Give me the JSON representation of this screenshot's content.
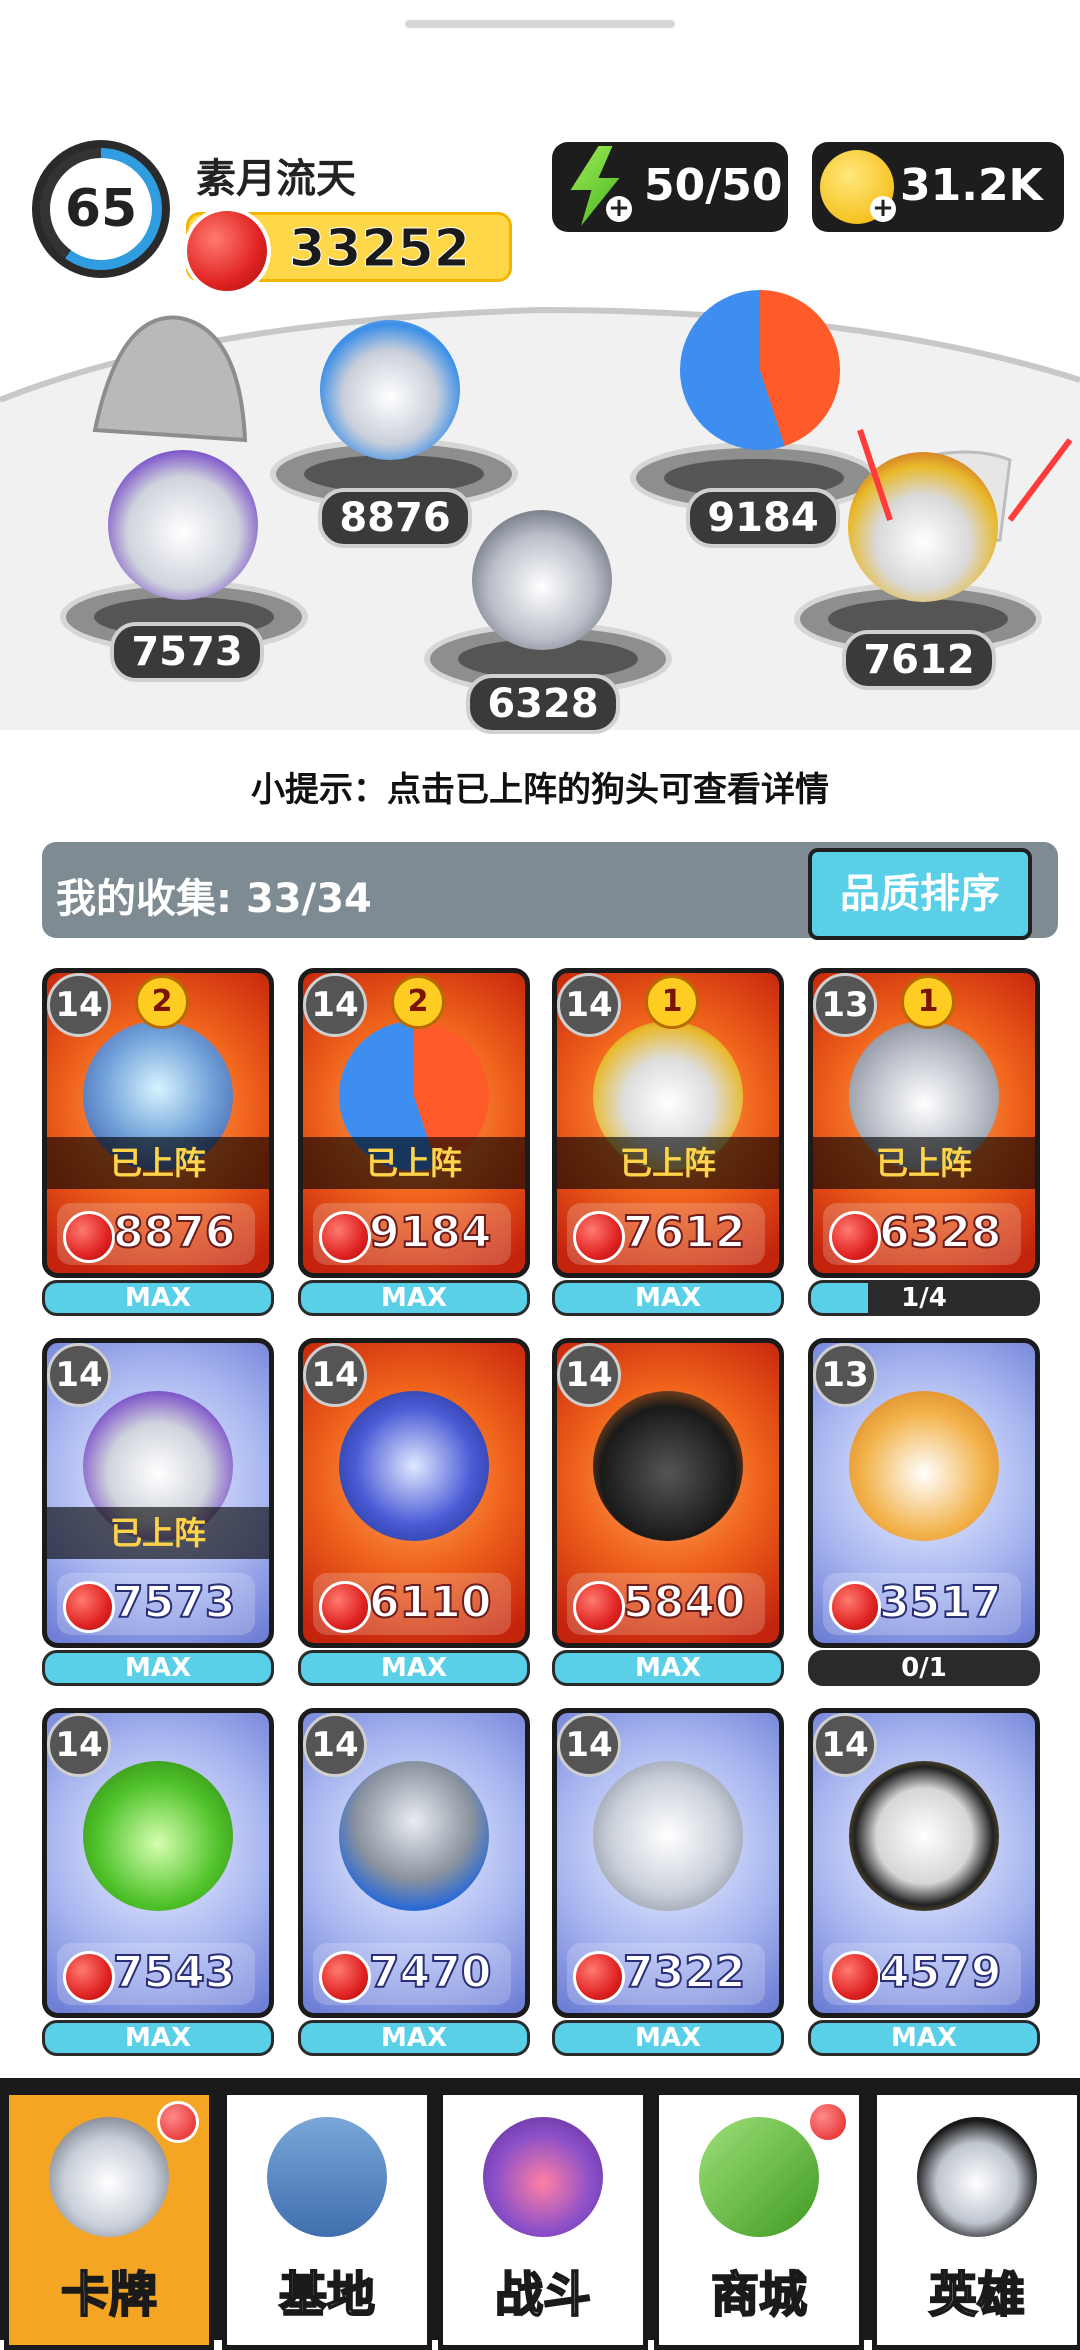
{
  "player": {
    "level": "65",
    "name": "素月流天",
    "power": "33252"
  },
  "resources": {
    "energy": "50/50",
    "gold": "31.2K"
  },
  "arena": {
    "powers": [
      "7573",
      "8876",
      "6328",
      "9184",
      "7612"
    ]
  },
  "tip": "小提示：点击已上阵的狗头可查看详情",
  "collection": {
    "label": "我的收集:",
    "count": "33/34",
    "sort_button": "品质排序"
  },
  "deployed_label": "已上阵",
  "cards": [
    {
      "level": "14",
      "rank": "2",
      "power": "8876",
      "deployed": true,
      "rarity": "red",
      "progress_text": "MAX",
      "progress": 1
    },
    {
      "level": "14",
      "rank": "2",
      "power": "9184",
      "deployed": true,
      "rarity": "red",
      "progress_text": "MAX",
      "progress": 1
    },
    {
      "level": "14",
      "rank": "1",
      "power": "7612",
      "deployed": true,
      "rarity": "red",
      "progress_text": "MAX",
      "progress": 1
    },
    {
      "level": "13",
      "rank": "1",
      "power": "6328",
      "deployed": true,
      "rarity": "red",
      "progress_text": "1/4",
      "progress": 0.25
    },
    {
      "level": "14",
      "rank": "",
      "power": "7573",
      "deployed": true,
      "rarity": "blue",
      "progress_text": "MAX",
      "progress": 1
    },
    {
      "level": "14",
      "rank": "",
      "power": "6110",
      "deployed": false,
      "rarity": "red",
      "progress_text": "MAX",
      "progress": 1
    },
    {
      "level": "14",
      "rank": "",
      "power": "5840",
      "deployed": false,
      "rarity": "red",
      "progress_text": "MAX",
      "progress": 1
    },
    {
      "level": "13",
      "rank": "",
      "power": "3517",
      "deployed": false,
      "rarity": "blue",
      "progress_text": "0/1",
      "progress": 0
    },
    {
      "level": "14",
      "rank": "",
      "power": "7543",
      "deployed": false,
      "rarity": "blue",
      "progress_text": "MAX",
      "progress": 1
    },
    {
      "level": "14",
      "rank": "",
      "power": "7470",
      "deployed": false,
      "rarity": "blue",
      "progress_text": "MAX",
      "progress": 1
    },
    {
      "level": "14",
      "rank": "",
      "power": "7322",
      "deployed": false,
      "rarity": "blue",
      "progress_text": "MAX",
      "progress": 1
    },
    {
      "level": "14",
      "rank": "",
      "power": "4579",
      "deployed": false,
      "rarity": "blue",
      "progress_text": "MAX",
      "progress": 1
    }
  ],
  "nav": {
    "tabs": [
      {
        "label": "卡牌",
        "icon": "dog-icon",
        "active": true,
        "badge": true
      },
      {
        "label": "基地",
        "icon": "castle-icon",
        "active": false,
        "badge": false
      },
      {
        "label": "战斗",
        "icon": "paw-icon",
        "active": false,
        "badge": false
      },
      {
        "label": "商城",
        "icon": "money-icon",
        "active": false,
        "badge": true
      },
      {
        "label": "英雄",
        "icon": "hero-dog-icon",
        "active": false,
        "badge": false
      }
    ]
  },
  "colors": {
    "accent": "#5ad0e8",
    "active_tab": "#f5a524",
    "power_pill": "#ffd84a"
  }
}
